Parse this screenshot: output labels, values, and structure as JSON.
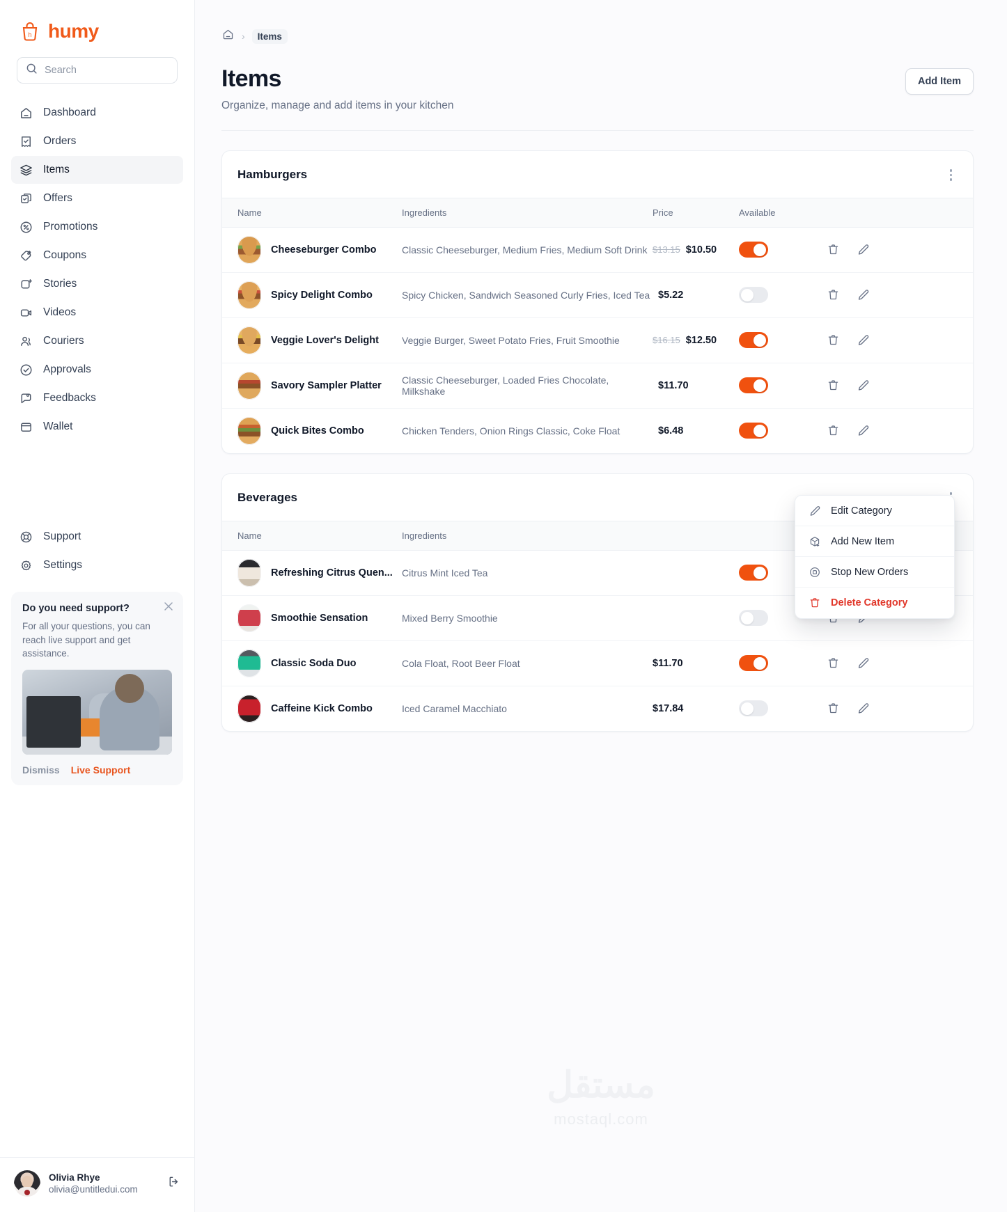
{
  "brand": {
    "name": "humy",
    "logo_icon": "bag-logo-icon",
    "color": "#f05a1a"
  },
  "search": {
    "placeholder": "Search",
    "icon": "search-icon"
  },
  "sidebar": {
    "items": [
      {
        "label": "Dashboard",
        "icon": "home-icon"
      },
      {
        "label": "Orders",
        "icon": "receipt-check-icon"
      },
      {
        "label": "Items",
        "icon": "layers-icon"
      },
      {
        "label": "Offers",
        "icon": "offer-copy-icon"
      },
      {
        "label": "Promotions",
        "icon": "percent-circle-icon"
      },
      {
        "label": "Coupons",
        "icon": "tag-icon"
      },
      {
        "label": "Stories",
        "icon": "camera-plus-icon"
      },
      {
        "label": "Videos",
        "icon": "video-icon"
      },
      {
        "label": "Couriers",
        "icon": "users-icon"
      },
      {
        "label": "Approvals",
        "icon": "check-circle-icon"
      },
      {
        "label": "Feedbacks",
        "icon": "feedback-icon"
      },
      {
        "label": "Wallet",
        "icon": "wallet-icon"
      }
    ],
    "bottom_items": [
      {
        "label": "Support",
        "icon": "lifebuoy-icon"
      },
      {
        "label": "Settings",
        "icon": "gear-icon"
      }
    ],
    "support_card": {
      "title": "Do you need support?",
      "description": "For all your questions, you can reach live support and get assistance.",
      "dismiss_label": "Dismiss",
      "live_support_label": "Live Support",
      "close_icon": "close-icon",
      "image_alt": "support-agent-photo"
    },
    "user": {
      "name": "Olivia Rhye",
      "email": "olivia@untitledui.com",
      "logout_icon": "logout-icon",
      "avatar": "user-avatar"
    }
  },
  "breadcrumb": {
    "home_icon": "home-icon",
    "separator": "›",
    "current": "Items"
  },
  "header": {
    "title": "Items",
    "subtitle": "Organize, manage and add items in your kitchen",
    "add_item_label": "Add Item"
  },
  "table_columns": {
    "name": "Name",
    "ingredients": "Ingredients",
    "price": "Price",
    "available": "Available"
  },
  "categories": [
    {
      "title": "Hamburgers",
      "kebab_icon": "more-vertical-icon",
      "rows": [
        {
          "name": "Cheeseburger Combo",
          "thumb": "burger",
          "ingredients": "Classic Cheeseburger, Medium Fries, Medium Soft Drink",
          "price_old": "$13.15",
          "price": "$10.50",
          "available": true
        },
        {
          "name": "Spicy Delight Combo",
          "thumb": "burger2",
          "ingredients": "Spicy Chicken, Sandwich Seasoned Curly Fries, Iced Tea",
          "price_old": "",
          "price": "$5.22",
          "available": false
        },
        {
          "name": "Veggie Lover's Delight",
          "thumb": "burger3",
          "ingredients": "Veggie Burger, Sweet Potato Fries, Fruit Smoothie",
          "price_old": "$16.15",
          "price": "$12.50",
          "available": true
        },
        {
          "name": "Savory Sampler Platter",
          "thumb": "burger4",
          "ingredients": "Classic Cheeseburger, Loaded Fries Chocolate, Milkshake",
          "price_old": "",
          "price": "$11.70",
          "available": true
        },
        {
          "name": "Quick Bites Combo",
          "thumb": "burger5",
          "ingredients": "Chicken Tenders, Onion Rings Classic, Coke Float",
          "price_old": "",
          "price": "$6.48",
          "available": true
        }
      ]
    },
    {
      "title": "Beverages",
      "kebab_icon": "more-vertical-icon",
      "rows": [
        {
          "name": "Refreshing Citrus Quen...",
          "thumb": "coffee",
          "ingredients": "Citrus Mint Iced Tea",
          "price_old": "",
          "price": "",
          "available": true
        },
        {
          "name": "Smoothie Sensation",
          "thumb": "smoothie",
          "ingredients": "Mixed Berry Smoothie",
          "price_old": "",
          "price": "",
          "available": false
        },
        {
          "name": "Classic Soda Duo",
          "thumb": "soda",
          "ingredients": "Cola Float, Root Beer Float",
          "price_old": "",
          "price": "$11.70",
          "available": true
        },
        {
          "name": "Caffeine Kick Combo",
          "thumb": "cola",
          "ingredients": "Iced Caramel Macchiato",
          "price_old": "",
          "price": "$17.84",
          "available": false
        }
      ]
    }
  ],
  "row_actions": {
    "delete_icon": "trash-icon",
    "edit_icon": "pencil-icon"
  },
  "category_menu": {
    "items": [
      {
        "label": "Edit Category",
        "icon": "pencil-icon",
        "danger": false
      },
      {
        "label": "Add New Item",
        "icon": "box-plus-icon",
        "danger": false
      },
      {
        "label": "Stop New Orders",
        "icon": "stop-circle-icon",
        "danger": false
      },
      {
        "label": "Delete Category",
        "icon": "trash-icon",
        "danger": true
      }
    ],
    "danger_color": "#e1372a"
  },
  "watermark": {
    "arabic": "مستقل",
    "latin": "mostaql.com"
  }
}
